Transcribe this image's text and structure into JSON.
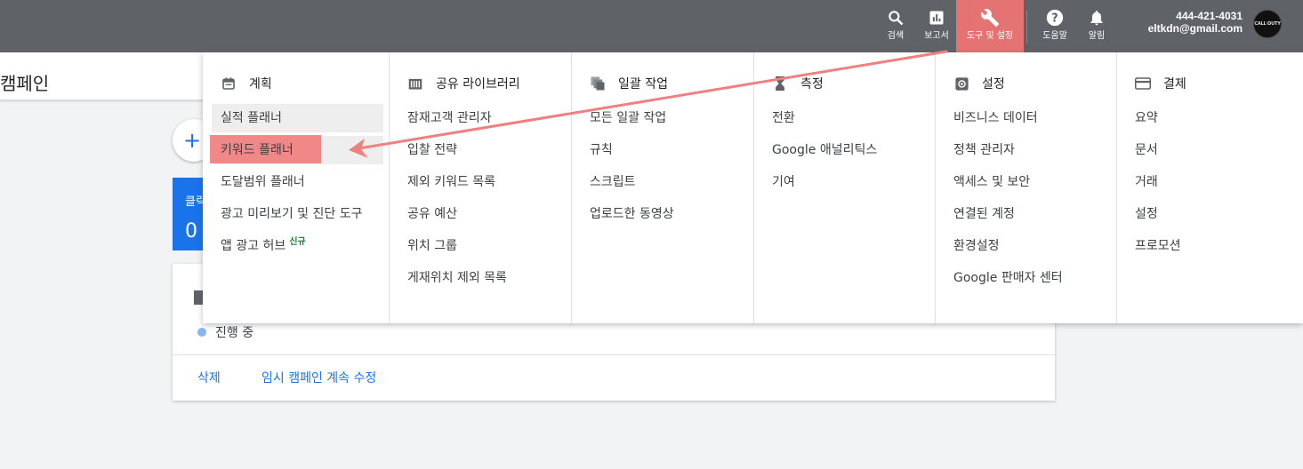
{
  "topbar": {
    "search_label": "검색",
    "reports_label": "보고서",
    "tools_label": "도구 및 설정",
    "help_label": "도움말",
    "notifications_label": "알림",
    "account_id": "444-421-4031",
    "account_email": "eltkdn@gmail.com",
    "avatar_text": "CALL·DUTY"
  },
  "page": {
    "title": "캠페인",
    "fab_symbol": "+",
    "card_label": "클릭",
    "card_value": "0",
    "campaign_status": "진행 중",
    "delete_link": "삭제",
    "edit_link": "임시 캠페인 계속 수정"
  },
  "menu": {
    "columns": [
      {
        "heading": "계획",
        "icon": "calendar-icon",
        "items": [
          "실적 플래너",
          "키워드 플래너",
          "도달범위 플래너",
          "광고 미리보기 및 진단 도구",
          "앱 광고 허브"
        ],
        "new_badge": "신규"
      },
      {
        "heading": "공유 라이브러리",
        "icon": "library-icon",
        "items": [
          "잠재고객 관리자",
          "입찰 전략",
          "제외 키워드 목록",
          "공유 예산",
          "위치 그룹",
          "게재위치 제외 목록"
        ]
      },
      {
        "heading": "일괄 작업",
        "icon": "bulk-actions-icon",
        "items": [
          "모든 일괄 작업",
          "규칙",
          "스크립트",
          "업로드한 동영상"
        ]
      },
      {
        "heading": "측정",
        "icon": "hourglass-icon",
        "items": [
          "전환",
          "Google 애널리틱스",
          "기여"
        ]
      },
      {
        "heading": "설정",
        "icon": "settings-icon",
        "items": [
          "비즈니스 데이터",
          "정책 관리자",
          "액세스 및 보안",
          "연결된 계정",
          "환경설정",
          "Google 판매자 센터"
        ]
      },
      {
        "heading": "결제",
        "icon": "credit-card-icon",
        "items": [
          "요약",
          "문서",
          "거래",
          "설정",
          "프로모션"
        ]
      }
    ]
  },
  "colors": {
    "topbar": "#5f6368",
    "highlight": "#e57373",
    "arrow": "#f08080",
    "link": "#1a73e8"
  }
}
